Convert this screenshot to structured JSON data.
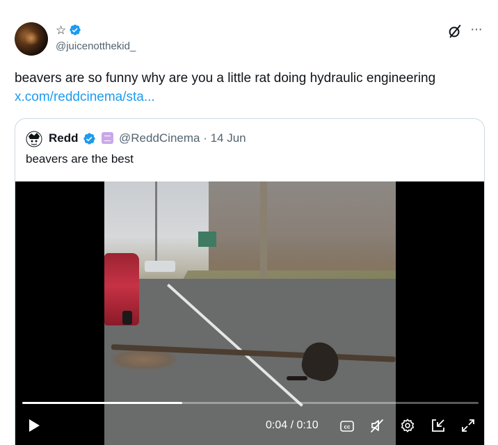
{
  "post": {
    "author_display_suffix": "☆",
    "handle": "@juicenotthekid_",
    "text": "beavers are so funny why are you a little rat doing hydraulic engineering",
    "link_text": "x.com/reddcinema/sta..."
  },
  "quoted": {
    "name": "Redd",
    "handle_date": "@ReddCinema · 14 Jun",
    "text": "beavers are the best"
  },
  "video": {
    "time": "0:04 / 0:10",
    "progress": 0.35
  },
  "icons": {
    "verified": "verified-badge-icon",
    "grok": "grok-icon",
    "more": "more-icon",
    "play": "play-icon",
    "captions": "captions-icon",
    "mute": "muted-speaker-icon",
    "settings": "gear-icon",
    "dock": "dock-icon",
    "fullscreen": "expand-icon"
  },
  "colors": {
    "link": "#1d9bf0",
    "verified": "#1d9bf0",
    "secondary_text": "#536471"
  }
}
